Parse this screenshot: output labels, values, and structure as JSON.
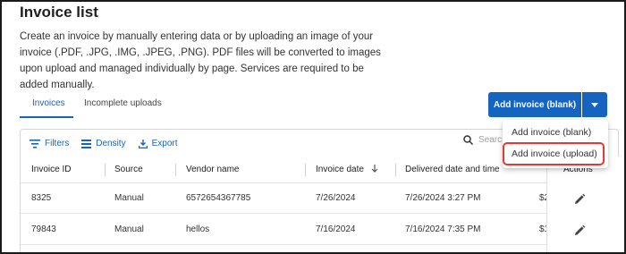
{
  "page": {
    "title": "Invoice list",
    "description": "Create an invoice by manually entering data or by uploading an image of your invoice (.PDF, .JPG, .IMG, .JPEG, .PNG). PDF files will be converted to images upon upload and managed individually by page. Services are required to be added manually."
  },
  "tabs": [
    {
      "label": "Invoices",
      "active": true
    },
    {
      "label": "Incomplete uploads",
      "active": false
    }
  ],
  "add_button": {
    "label": "Add invoice (blank)",
    "caret_icon": "caret-down-icon"
  },
  "dropdown": {
    "items": [
      "Add invoice (blank)",
      "Add invoice (upload)"
    ],
    "highlighted": "Add invoice (upload)",
    "highlight_color": "#e53935"
  },
  "toolbar": {
    "filters": "Filters",
    "density": "Density",
    "export": "Export",
    "search_placeholder": "Searc"
  },
  "table": {
    "columns": [
      "Invoice ID",
      "Source",
      "Vendor name",
      "Invoice date",
      "Delivered date and time",
      "Actions"
    ],
    "rows": [
      {
        "invoice_id": "8325",
        "source": "Manual",
        "vendor": "6572654367785",
        "invoice_date": "7/26/2024",
        "delivered": "7/26/2024 3:27 PM",
        "extra": "$2"
      },
      {
        "invoice_id": "79843",
        "source": "Manual",
        "vendor": "hellos",
        "invoice_date": "7/16/2024",
        "delivered": "7/16/2024 7:35 PM",
        "extra": "$1"
      }
    ]
  },
  "colors": {
    "accent": "#1565c0",
    "highlight": "#e53935"
  }
}
